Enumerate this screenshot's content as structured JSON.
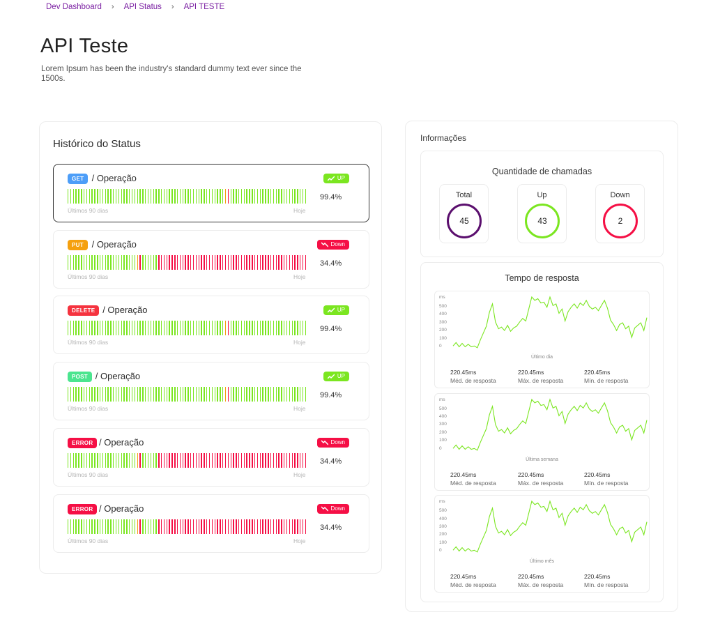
{
  "breadcrumb": [
    "Dev Dashboard",
    "API Status",
    "API TESTE"
  ],
  "page": {
    "title": "API Teste",
    "subtitle": "Lorem Ipsum has been the industry's standard dummy text ever since the 1500s."
  },
  "history": {
    "title": "Histórico do Status",
    "range_start": "Últimos 90 dias",
    "range_end": "Hoje",
    "operations": [
      {
        "method": "GET",
        "method_color": "#4d9ef8",
        "name": "/ Operação",
        "status": "UP",
        "status_kind": "up",
        "percent": "99.4%",
        "bar_pattern": "up",
        "selected": true
      },
      {
        "method": "PUT",
        "method_color": "#f5a00f",
        "name": "/ Operação",
        "status": "Down",
        "status_kind": "down",
        "percent": "34.4%",
        "bar_pattern": "down",
        "selected": false
      },
      {
        "method": "DELETE",
        "method_color": "#f5333f",
        "name": "/ Operação",
        "status": "UP",
        "status_kind": "up",
        "percent": "99.4%",
        "bar_pattern": "up",
        "selected": false
      },
      {
        "method": "POST",
        "method_color": "#4be58f",
        "name": "/ Operação",
        "status": "UP",
        "status_kind": "up",
        "percent": "99.4%",
        "bar_pattern": "up",
        "selected": false
      },
      {
        "method": "ERROR",
        "method_color": "#f50f45",
        "name": "/ Operação",
        "status": "Down",
        "status_kind": "down",
        "percent": "34.4%",
        "bar_pattern": "down",
        "selected": false
      },
      {
        "method": "ERROR",
        "method_color": "#f50f45",
        "name": "/ Operação",
        "status": "Down",
        "status_kind": "down",
        "percent": "34.4%",
        "bar_pattern": "down",
        "selected": false
      }
    ]
  },
  "info": {
    "title": "Informações",
    "calls": {
      "title": "Quantidade de chamadas",
      "stats": [
        {
          "label": "Total",
          "value": "45",
          "color": "#5b0f6e"
        },
        {
          "label": "Up",
          "value": "43",
          "color": "#7be620"
        },
        {
          "label": "Down",
          "value": "2",
          "color": "#f50f45"
        }
      ]
    },
    "response": {
      "title": "Tempo de resposta",
      "unit": "ms",
      "yticks": [
        "500",
        "400",
        "300",
        "200",
        "100",
        "0"
      ],
      "line_color": "#7be620",
      "charts": [
        {
          "caption": "Último dia"
        },
        {
          "caption": "Última semana"
        },
        {
          "caption": "Último mês"
        }
      ],
      "series": [
        30,
        70,
        20,
        60,
        20,
        50,
        20,
        30,
        10,
        100,
        180,
        260,
        420,
        520,
        310,
        230,
        250,
        210,
        270,
        200,
        240,
        260,
        310,
        350,
        320,
        460,
        600,
        560,
        580,
        530,
        540,
        480,
        600,
        500,
        520,
        410,
        460,
        320,
        430,
        480,
        520,
        470,
        530,
        500,
        560,
        490,
        460,
        480,
        440,
        500,
        560,
        470,
        330,
        280,
        210,
        280,
        300,
        230,
        260,
        130,
        240,
        270,
        300,
        210,
        360
      ],
      "metrics": [
        {
          "value": "220.45ms",
          "label": "Méd. de resposta"
        },
        {
          "value": "220.45ms",
          "label": "Máx. de resposta"
        },
        {
          "value": "220.45ms",
          "label": "Mín. de resposta"
        }
      ]
    }
  }
}
